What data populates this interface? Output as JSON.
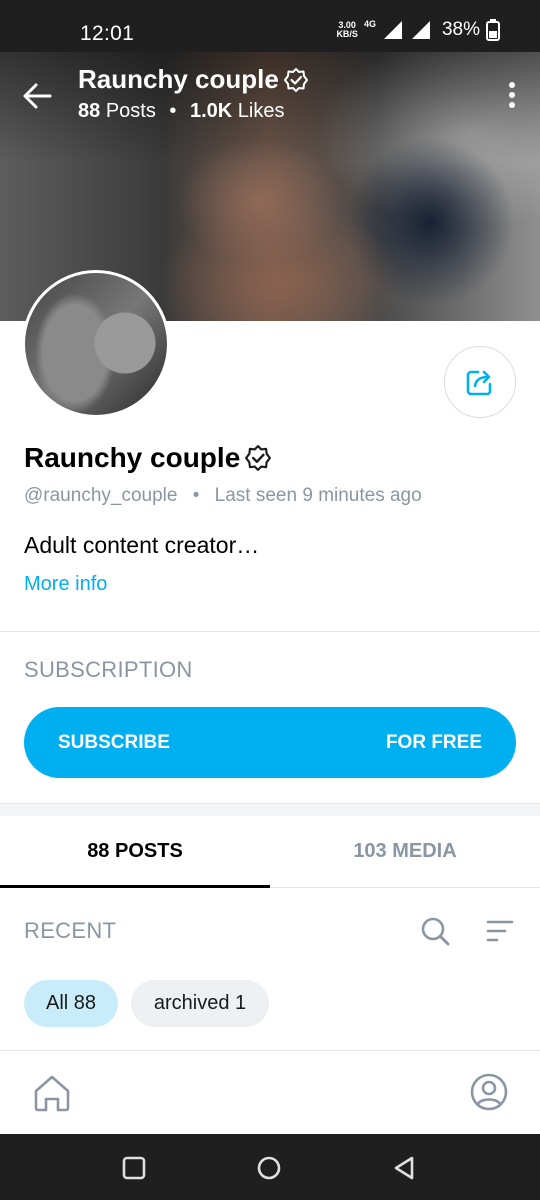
{
  "status_bar": {
    "time": "12:01",
    "net_speed_value": "3.00",
    "net_speed_unit": "KB/S",
    "network": "4G",
    "battery": "38%"
  },
  "header": {
    "title": "Raunchy couple",
    "posts_count": "88",
    "posts_label": "Posts",
    "likes_count": "1.0K",
    "likes_label": "Likes",
    "separator": "•"
  },
  "profile": {
    "name": "Raunchy couple",
    "handle": "@raunchy_couple",
    "separator": "•",
    "last_seen": "Last seen 9 minutes ago",
    "bio": "Adult content creator…",
    "more_info": "More info"
  },
  "subscription": {
    "section_label": "SUBSCRIPTION",
    "button_left": "SUBSCRIBE",
    "button_right": "FOR FREE"
  },
  "tabs": [
    {
      "label": "88 POSTS",
      "active": true
    },
    {
      "label": "103 MEDIA",
      "active": false
    }
  ],
  "recent": {
    "label": "RECENT",
    "chips": [
      {
        "label": "All 88",
        "selected": true
      },
      {
        "label": "archived 1",
        "selected": false
      }
    ]
  },
  "colors": {
    "accent": "#00aff0",
    "muted_text": "#8a96a3",
    "chip_selected": "#c9ecfb"
  },
  "icons": {
    "back": "arrow-left-icon",
    "verified": "verified-badge-icon",
    "more": "more-vertical-icon",
    "share": "share-icon",
    "search": "search-icon",
    "sort": "sort-icon",
    "home": "home-icon",
    "profile": "profile-icon"
  }
}
